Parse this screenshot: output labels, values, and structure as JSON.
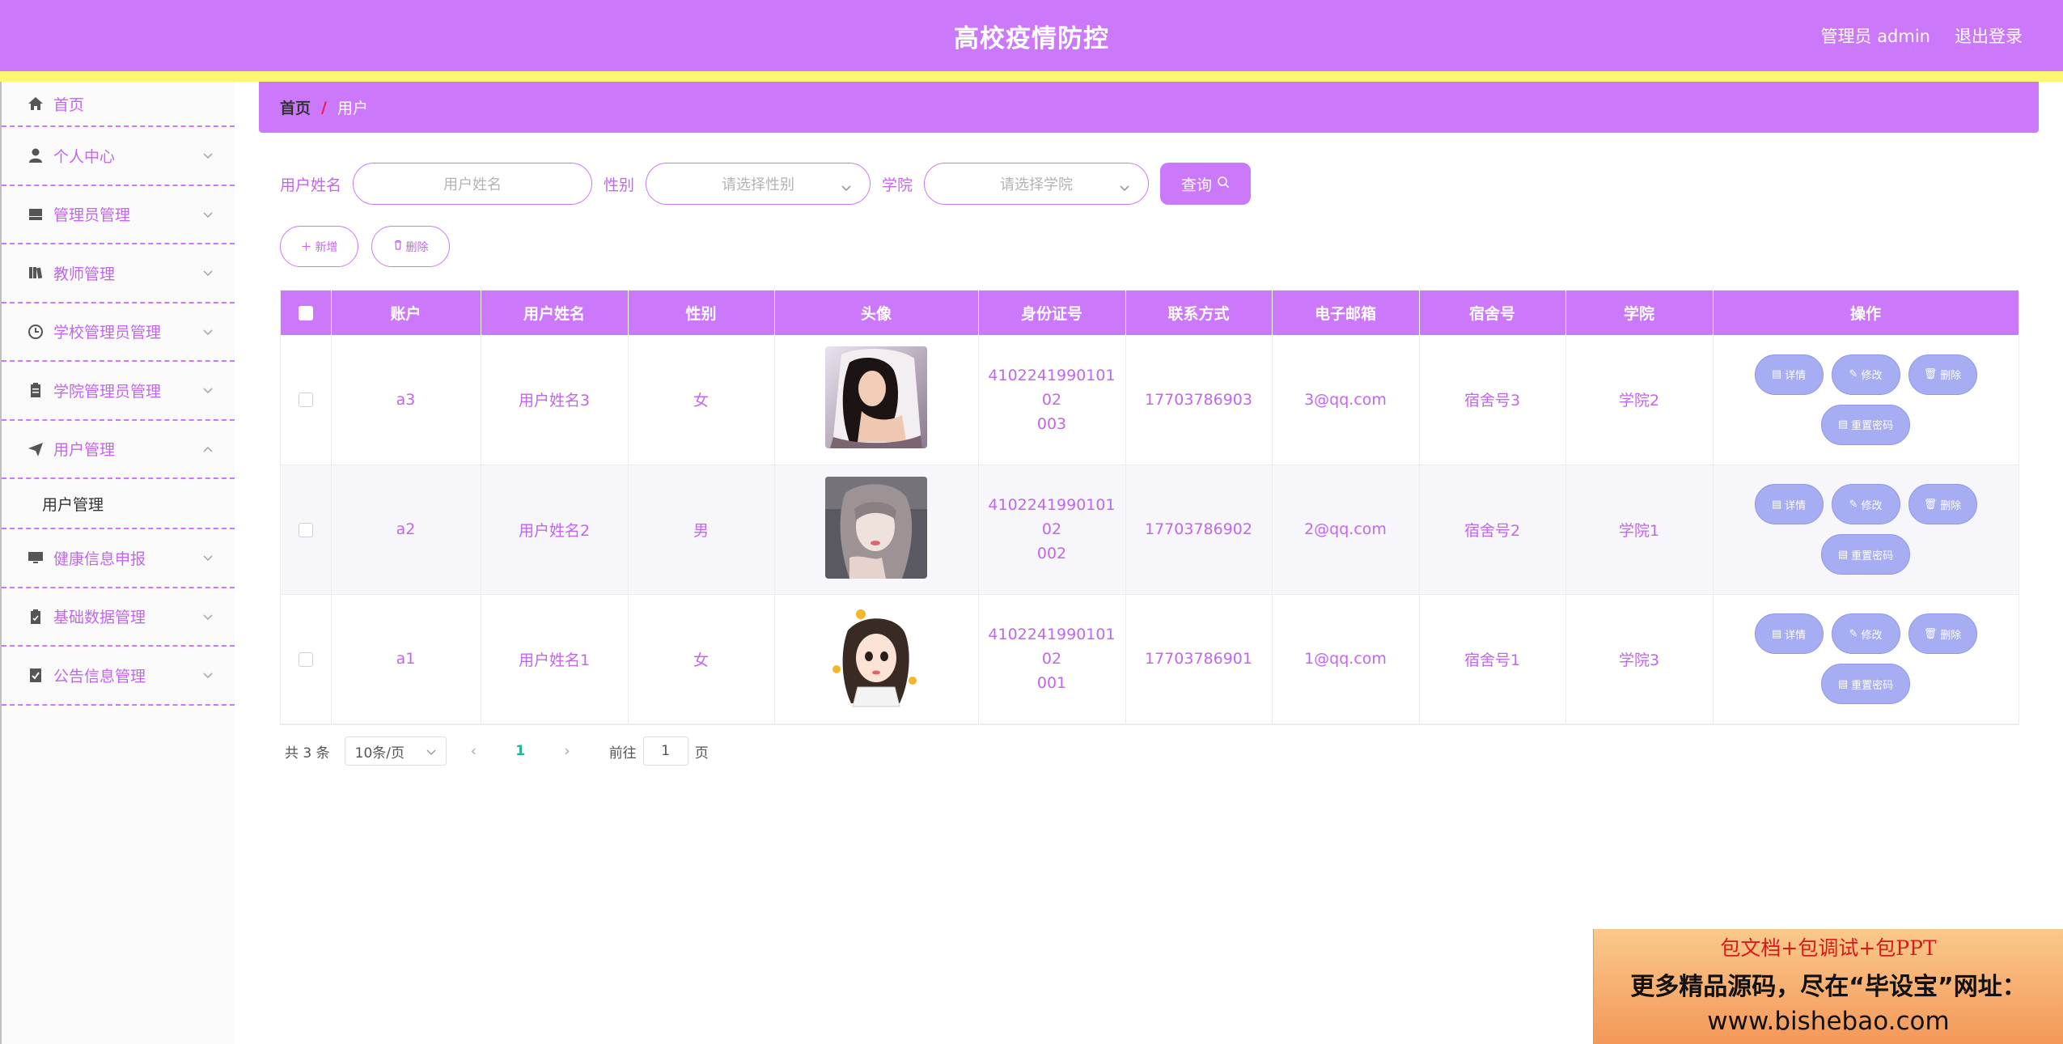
{
  "header": {
    "title": "高校疫情防控",
    "user_label": "管理员 admin",
    "logout_label": "退出登录"
  },
  "sidebar": {
    "items": [
      {
        "label": "首页",
        "icon": "home-icon"
      },
      {
        "label": "个人中心",
        "icon": "user-icon"
      },
      {
        "label": "管理员管理",
        "icon": "storage-icon"
      },
      {
        "label": "教师管理",
        "icon": "books-icon"
      },
      {
        "label": "学校管理员管理",
        "icon": "clock-icon"
      },
      {
        "label": "学院管理员管理",
        "icon": "clipboard-icon"
      },
      {
        "label": "用户管理",
        "icon": "send-icon",
        "expanded": true
      },
      {
        "label": "健康信息申报",
        "icon": "monitor-icon"
      },
      {
        "label": "基础数据管理",
        "icon": "checklist-icon"
      },
      {
        "label": "公告信息管理",
        "icon": "check-doc-icon"
      }
    ],
    "submenu_label": "用户管理"
  },
  "breadcrumb": {
    "home": "首页",
    "separator": "/",
    "current": "用户"
  },
  "search": {
    "name_label": "用户姓名",
    "name_placeholder": "用户姓名",
    "gender_label": "性别",
    "gender_placeholder": "请选择性别",
    "college_label": "学院",
    "college_placeholder": "请选择学院",
    "query_label": "查询"
  },
  "actions": {
    "add_label": "新增",
    "delete_label": "删除"
  },
  "table": {
    "headers": [
      "账户",
      "用户姓名",
      "性别",
      "头像",
      "身份证号",
      "联系方式",
      "电子邮箱",
      "宿舍号",
      "学院",
      "操作"
    ],
    "rows": [
      {
        "account": "a3",
        "name": "用户姓名3",
        "gender": "女",
        "id_line1": "410224199010102",
        "id_line2": "003",
        "phone": "17703786903",
        "email": "3@qq.com",
        "dorm": "宿舍号3",
        "college": "学院2"
      },
      {
        "account": "a2",
        "name": "用户姓名2",
        "gender": "男",
        "id_line1": "410224199010102",
        "id_line2": "002",
        "phone": "17703786902",
        "email": "2@qq.com",
        "dorm": "宿舍号2",
        "college": "学院1"
      },
      {
        "account": "a1",
        "name": "用户姓名1",
        "gender": "女",
        "id_line1": "410224199010102",
        "id_line2": "001",
        "phone": "17703786901",
        "email": "1@qq.com",
        "dorm": "宿舍号1",
        "college": "学院3"
      }
    ],
    "ops": {
      "detail": "详情",
      "edit": "修改",
      "delete": "删除",
      "reset": "重置密码"
    }
  },
  "pagination": {
    "total": "共 3 条",
    "page_size": "10条/页",
    "current_page": "1",
    "goto_prefix": "前往",
    "goto_value": "1",
    "goto_suffix": "页"
  },
  "ad": {
    "line1": "包文档+包调试+包PPT",
    "line2": "更多精品源码，尽在“毕设宝”网址：",
    "line3": "www.bishebao.com"
  },
  "colors": {
    "primary": "#cb78fb",
    "accent_strip": "#fbf772",
    "op_button": "#a6adf2",
    "page_active": "#1fb59a"
  }
}
